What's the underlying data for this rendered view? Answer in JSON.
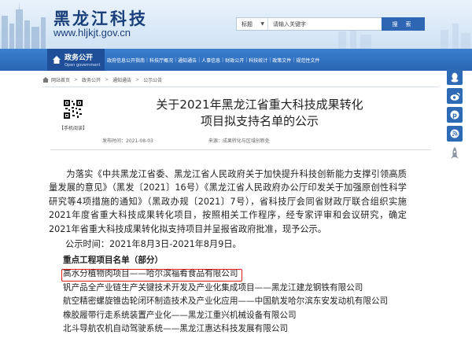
{
  "header": {
    "site_title": "黑龙江科技",
    "site_url": "www.hljkjt.gov.cn",
    "search": {
      "select_label": "标题",
      "placeholder": "请输入关键字",
      "button_label": "搜 索"
    }
  },
  "nav": {
    "gov_title": "政务公开",
    "gov_sub": "Open government",
    "links": [
      "政府信息公开指南",
      "科技厅概况",
      "通知通告",
      "人事信息",
      "财政公开",
      "科技统计",
      "政策文件",
      "规范性文件"
    ]
  },
  "breadcrumb": [
    "网站首页",
    "政务公开",
    "通知通告",
    "公示公告"
  ],
  "qr_label": "【手机阅读】",
  "article": {
    "title_line1": "关于2021年黑龙江省重大科技成果转化",
    "title_line2": "项目拟支持名单的公示",
    "publish_time": "发布时间：2021-08-03",
    "source": "来源：成果转化与区域创新处",
    "body": "为落实《中共黑龙江省委、黑龙江省人民政府关于加快提升科技创新能力支撑引领高质量发展的意见》（黑发〔2021〕16号）《黑龙江省人民政府办公厅印发关于加强原创性科学研究等4项措施的通知》（黑政办规〔2021〕7号），省科技厅会同省财政厅联合组织实施2021年度省重大科技成果转化项目，按照相关工作程序，经专家评审和会议研究，确定2021年省重大科技成果转化拟支持项目并呈报省政府批准，现予公示。",
    "period": "公示时间：2021年8月3日-2021年8月9日。",
    "projects_heading": "重点工程项目名单（部分）",
    "projects": [
      "高水分植物肉项目——哈尔滨福肴食品有限公司",
      "钒产品全产业链生产关键技术开发及产业化集成项目——黑龙江建龙钢铁有限公司",
      "航空精密螺旋锥齿轮闭环制造技术及产业化应用——中国航发哈尔滨东安发动机有限公司",
      "橡胶履带行走系统装置产业化——黑龙江重兴机械设备有限公司",
      "北斗导航农机自动驾驶系统——黑龙江惠达科技发展有限公司"
    ]
  },
  "colors": {
    "nav_blue": "#2a66b4",
    "title_blue": "#1a3f7a",
    "highlight_red": "#e0191a"
  },
  "share_icons": [
    "qq-icon",
    "weibo-icon",
    "pinterest-icon",
    "rss-icon",
    "back-to-top-rocket-icon"
  ]
}
